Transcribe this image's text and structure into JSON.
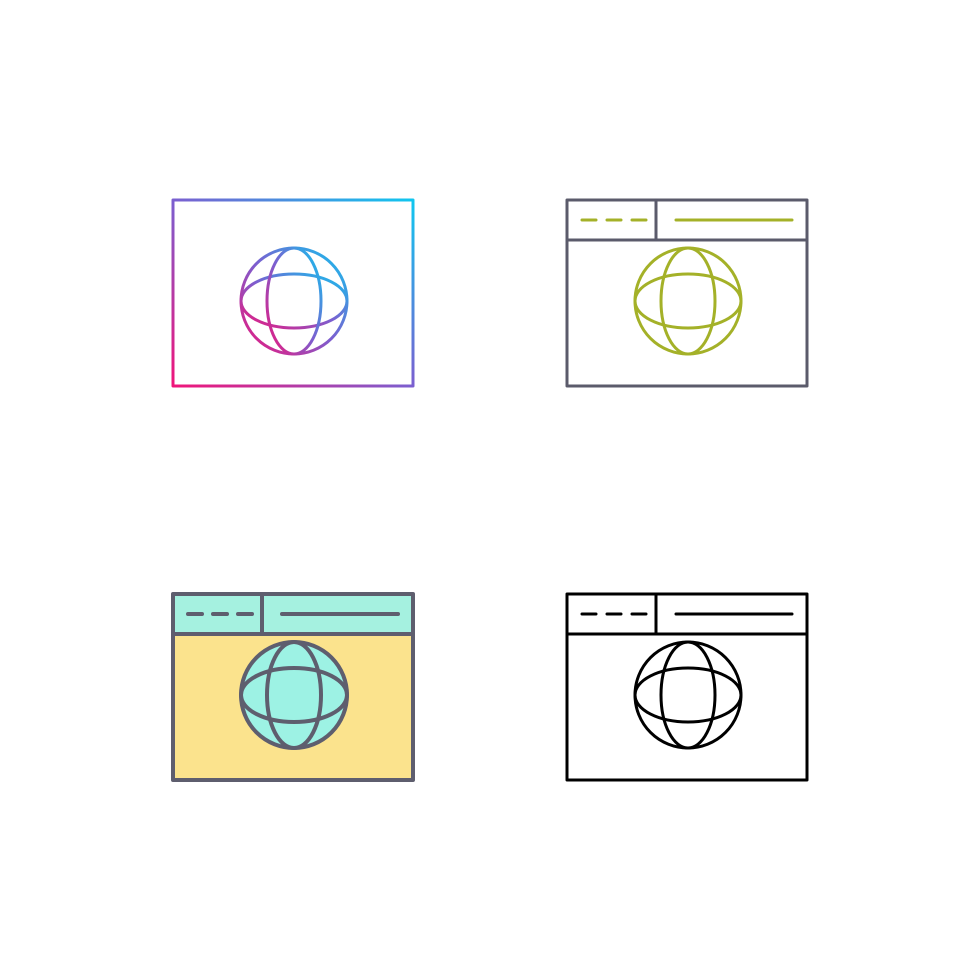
{
  "icons": [
    {
      "name": "browser-globe-gradient-icon",
      "style": "gradient-outline",
      "colors": {
        "gradient_start": "#f0157a",
        "gradient_mid": "#7b5fd0",
        "gradient_end": "#10c6ef"
      }
    },
    {
      "name": "browser-globe-two-tone-icon",
      "style": "two-tone-outline",
      "colors": {
        "frame": "#5b5b6b",
        "accent": "#a4b128"
      }
    },
    {
      "name": "browser-globe-filled-icon",
      "style": "filled-color",
      "colors": {
        "stroke": "#5e5e6e",
        "header_fill": "#a5f1e0",
        "body_fill": "#fbe38d",
        "globe_fill": "#9df2e4"
      }
    },
    {
      "name": "browser-globe-line-icon",
      "style": "black-line",
      "colors": {
        "stroke": "#000000"
      }
    }
  ]
}
